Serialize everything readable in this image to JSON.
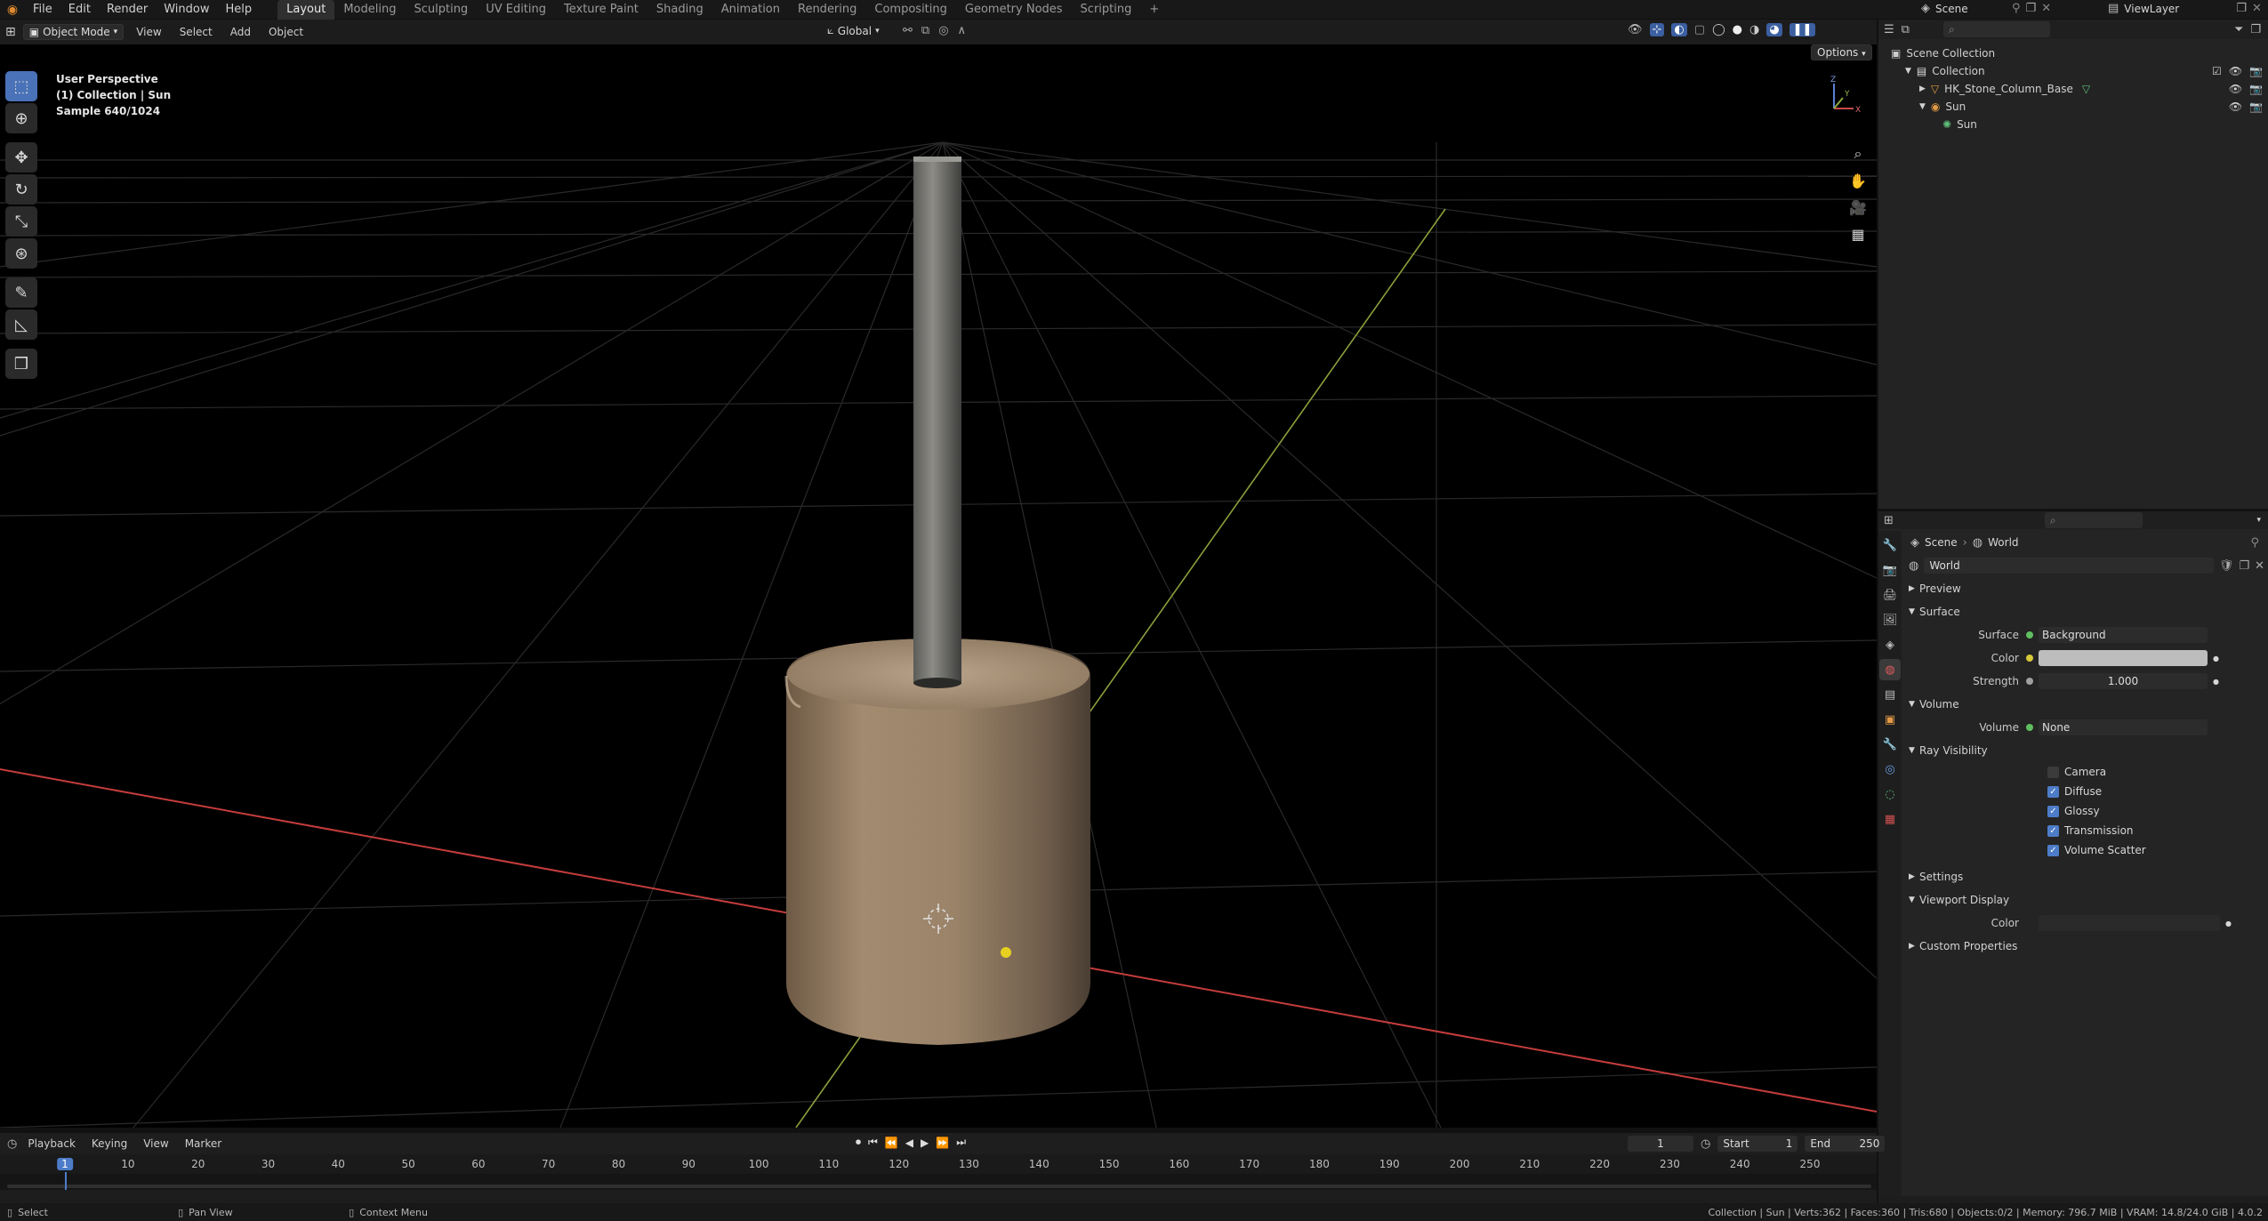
{
  "topbar": {
    "menus": [
      "File",
      "Edit",
      "Render",
      "Window",
      "Help"
    ],
    "workspaces": [
      "Layout",
      "Modeling",
      "Sculpting",
      "UV Editing",
      "Texture Paint",
      "Shading",
      "Animation",
      "Rendering",
      "Compositing",
      "Geometry Nodes",
      "Scripting"
    ],
    "active_workspace": "Layout",
    "add_tab": "+",
    "scene": "Scene",
    "view_layer": "ViewLayer"
  },
  "viewport_header": {
    "mode": "Object Mode",
    "menus": [
      "View",
      "Select",
      "Add",
      "Object"
    ],
    "orientation": "Global",
    "options": "Options"
  },
  "viewport": {
    "overlay_lines": [
      "User Perspective",
      "(1) Collection | Sun",
      "Sample 640/1024"
    ],
    "axis_labels": {
      "x": "X",
      "y": "Y",
      "z": "Z"
    }
  },
  "outliner": {
    "root": "Scene Collection",
    "items": [
      {
        "label": "Collection",
        "indent": 1
      },
      {
        "label": "HK_Stone_Column_Base",
        "indent": 2
      },
      {
        "label": "Sun",
        "indent": 2
      },
      {
        "label": "Sun",
        "indent": 3
      }
    ]
  },
  "properties": {
    "breadcrumb": [
      "Scene",
      "World"
    ],
    "world_name": "World",
    "panels": {
      "preview": "Preview",
      "surface": "Surface",
      "volume": "Volume",
      "ray_visibility": "Ray Visibility",
      "settings": "Settings",
      "viewport_display": "Viewport Display",
      "custom_properties": "Custom Properties"
    },
    "surface": {
      "surface_label": "Surface",
      "surface_value": "Background",
      "color_label": "Color",
      "color_value": "#bdbdbd",
      "strength_label": "Strength",
      "strength_value": "1.000"
    },
    "volume": {
      "volume_label": "Volume",
      "volume_value": "None"
    },
    "ray_visibility": [
      {
        "label": "Camera",
        "checked": false
      },
      {
        "label": "Diffuse",
        "checked": true
      },
      {
        "label": "Glossy",
        "checked": true
      },
      {
        "label": "Transmission",
        "checked": true
      },
      {
        "label": "Volume Scatter",
        "checked": true
      }
    ],
    "viewport_display": {
      "color_label": "Color"
    }
  },
  "timeline": {
    "menus": [
      "Playback",
      "Keying",
      "View",
      "Marker"
    ],
    "current_frame": "1",
    "start_label": "Start",
    "start_value": "1",
    "end_label": "End",
    "end_value": "250",
    "ticks": [
      "1",
      "10",
      "20",
      "30",
      "40",
      "50",
      "60",
      "70",
      "80",
      "90",
      "100",
      "110",
      "120",
      "130",
      "140",
      "150",
      "160",
      "170",
      "180",
      "190",
      "200",
      "210",
      "220",
      "230",
      "240",
      "250"
    ]
  },
  "statusbar": {
    "select": "Select",
    "pan": "Pan View",
    "context": "Context Menu",
    "stats": "Collection | Sun | Verts:362 | Faces:360 | Tris:680 | Objects:0/2 | Memory: 796.7 MiB | VRAM: 14.8/24.0 GiB | 4.0.2"
  },
  "colors": {
    "accent": "#4a72b8",
    "timeline_cursor": "#4d7cc8",
    "sun_dot": "#e8d020",
    "x_axis": "#c43c3c",
    "y_axis": "#8aa03a"
  }
}
